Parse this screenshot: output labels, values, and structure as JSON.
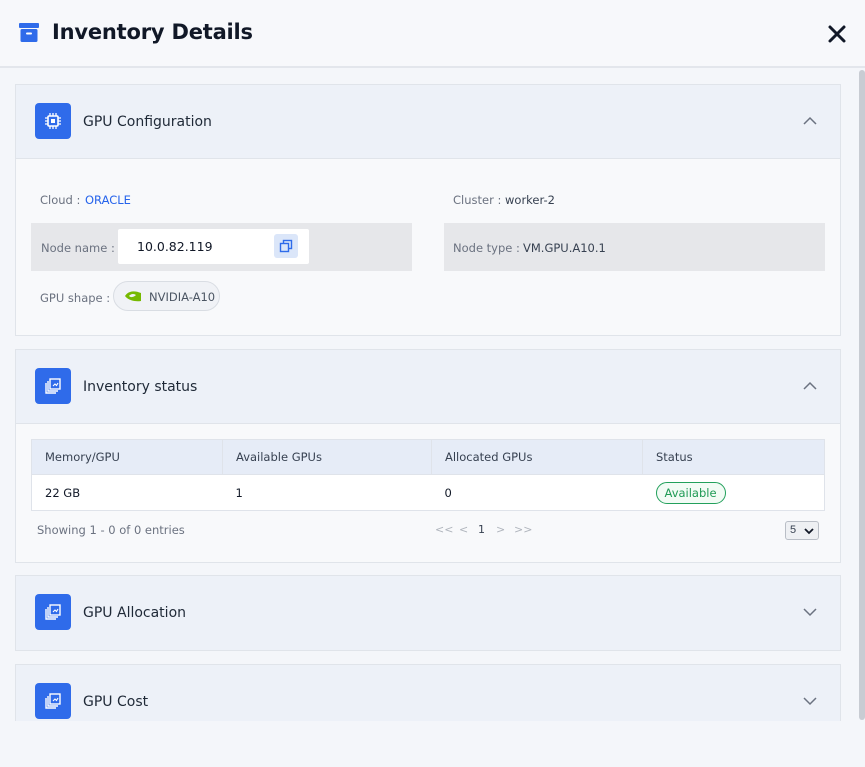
{
  "header": {
    "title": "Inventory Details",
    "icon": "archive-box-icon",
    "close_icon": "close-icon"
  },
  "gpu_config": {
    "title": "GPU Configuration",
    "icon": "chip-icon",
    "cloud_label": "Cloud :",
    "cloud_value": "ORACLE",
    "cluster_label": "Cluster :",
    "cluster_value": "worker-2",
    "node_name_label": "Node name :",
    "node_name_value": "10.0.82.119",
    "node_type_label": "Node type :",
    "node_type_value": "VM.GPU.A10.1",
    "gpu_shape_label": "GPU shape :",
    "gpu_shape_value": "NVIDIA-A10"
  },
  "inventory_status": {
    "title": "Inventory status",
    "columns": [
      "Memory/GPU",
      "Available GPUs",
      "Allocated GPUs",
      "Status"
    ],
    "rows": [
      {
        "memory": "22 GB",
        "available": "1",
        "allocated": "0",
        "status": "Available"
      }
    ],
    "showing_text": "Showing 1 - 0 of 0 entries",
    "pagination": {
      "first": "<<",
      "prev": "<",
      "current_page": "1",
      "next": ">",
      "last": ">>"
    },
    "page_size": "5"
  },
  "gpu_allocation": {
    "title": "GPU Allocation"
  },
  "gpu_cost": {
    "title": "GPU Cost"
  },
  "colors": {
    "accent": "#2f6bea",
    "link": "#2563eb",
    "status_green": "#1f9a55"
  }
}
